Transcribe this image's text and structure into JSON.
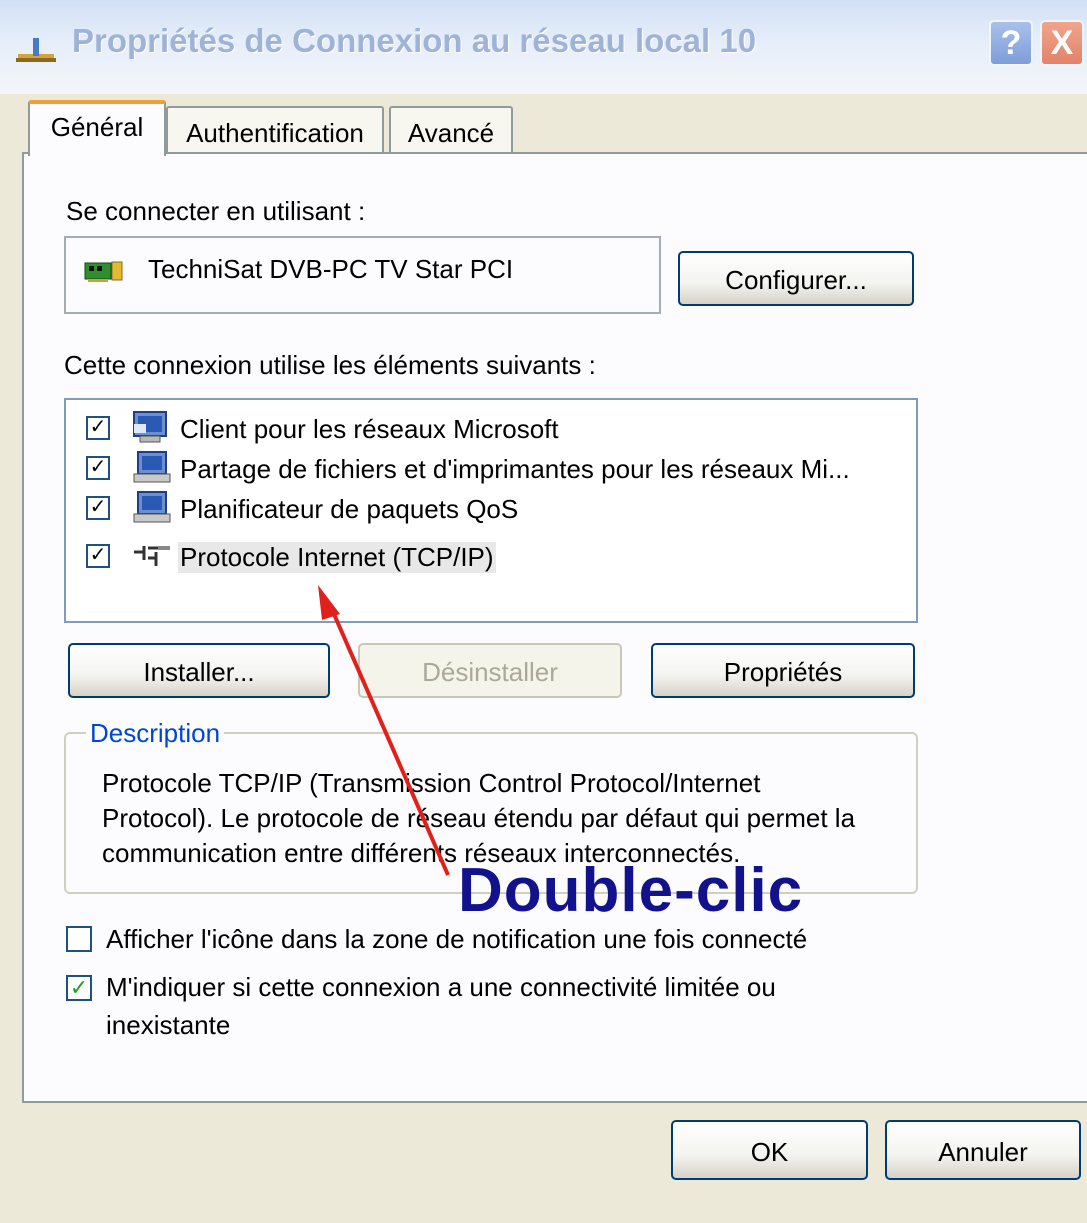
{
  "window": {
    "title": "Propriétés de Connexion au réseau local 10",
    "help_button": "?",
    "close_button": "X",
    "title_icon": "network-connection-icon"
  },
  "tabs": [
    {
      "label": "Général",
      "active": true
    },
    {
      "label": "Authentification",
      "active": false
    },
    {
      "label": "Avancé",
      "active": false
    }
  ],
  "connect_using": {
    "label": "Se connecter en utilisant :",
    "adapter_name": "TechniSat DVB-PC TV Star PCI",
    "adapter_icon": "network-adapter-icon",
    "configure_button": "Configurer..."
  },
  "components": {
    "label": "Cette connexion utilise les éléments suivants :",
    "items": [
      {
        "label": "Client pour les réseaux Microsoft",
        "checked": true,
        "icon": "computer-client-icon"
      },
      {
        "label": "Partage de fichiers et d'imprimantes pour les réseaux Mi...",
        "checked": true,
        "icon": "computer-service-icon"
      },
      {
        "label": "Planificateur de paquets QoS",
        "checked": true,
        "icon": "computer-service-icon"
      },
      {
        "label": "Protocole Internet (TCP/IP)",
        "checked": true,
        "icon": "protocol-icon",
        "selected": true
      }
    ],
    "install_button": "Installer...",
    "uninstall_button": "Désinstaller",
    "properties_button": "Propriétés"
  },
  "description": {
    "title": "Description",
    "text": "Protocole TCP/IP (Transmission Control Protocol/Internet Protocol). Le protocole de réseau étendu par défaut qui permet la communication entre différents réseaux interconnectés."
  },
  "options": {
    "show_icon": {
      "label": "Afficher l'icône dans la zone de notification une fois connecté",
      "checked": false
    },
    "notify_limited": {
      "label": "M'indiquer si cette connexion a une connectivité limitée ou inexistante",
      "checked": true
    }
  },
  "dialog_buttons": {
    "ok": "OK",
    "cancel": "Annuler"
  },
  "annotation": {
    "text": "Double-clic",
    "color": "#12128c",
    "arrow_color": "#e0201a"
  },
  "colors": {
    "title_bar": "#d2e0f6",
    "tab_highlight": "#f1a036",
    "button_border": "#003c74"
  }
}
